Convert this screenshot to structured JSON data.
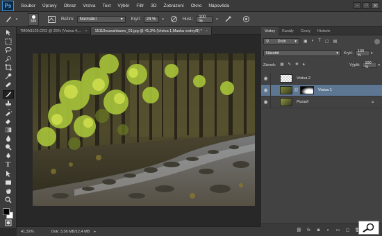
{
  "app": {
    "logo": "Ps"
  },
  "menu": [
    "Soubor",
    "Úpravy",
    "Obraz",
    "Vrstva",
    "Text",
    "Výběr",
    "Filtr",
    "3D",
    "Zobrazení",
    "Okno",
    "Nápověda"
  ],
  "window_controls": {
    "minimize": "–",
    "maximize": "□",
    "close": "✕"
  },
  "options": {
    "brush_size": "349",
    "mode_label": "Režim:",
    "mode_value": "Normální",
    "opacity_label": "Krytí:",
    "opacity_value": "24 %",
    "flow_label": "Hust.:",
    "flow_value": "100 %"
  },
  "tabs": [
    {
      "label": "7M0A3129.CR2 @ 25% (Vrstva 4,...",
      "close": "×",
      "active": false
    },
    {
      "label": "15110rozsahbarev_01.jpg @ 41,3% (Vrstva 1,Maska vrstvy/8) *",
      "close": "×",
      "active": true
    }
  ],
  "status": {
    "zoom": "41,32%",
    "doc": "Dok: 3,36 MB/12,4 MB",
    "arrow": "▸"
  },
  "panel": {
    "tabs": [
      "Vrstvy",
      "Kanály",
      "Cesty",
      "Historie"
    ],
    "filter_label": "Druh",
    "blend_mode": "Násobit",
    "opacity_label": "Krytí:",
    "opacity_value": "100 %",
    "lock_label": "Zámek:",
    "fill_label": "Výplň:",
    "fill_value": "100 %",
    "layers": [
      {
        "name": "Vrstva 2",
        "selected": false
      },
      {
        "name": "Vrstva 1",
        "selected": true
      },
      {
        "name": "Pozadí",
        "selected": false
      }
    ],
    "bottom_icons": [
      "fx"
    ]
  },
  "colors": {
    "accent": "#5d7692",
    "ps_blue": "#3d8fd6"
  }
}
